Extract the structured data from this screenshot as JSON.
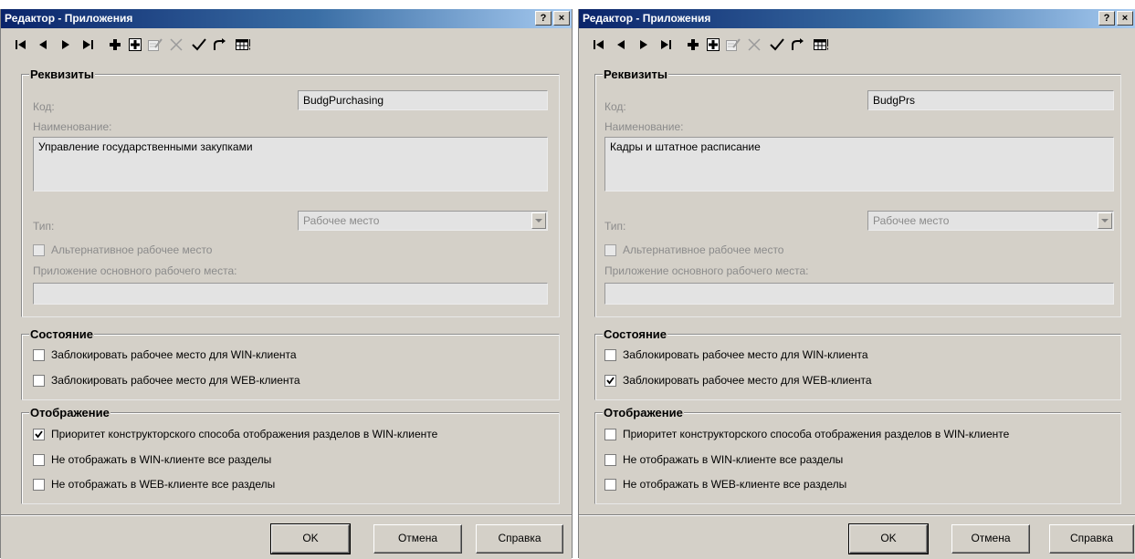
{
  "dialogs": [
    {
      "title": "Редактор - Приложения",
      "title_buttons": [
        "?",
        "×"
      ],
      "requisites": {
        "title": "Реквизиты",
        "code_label": "Код:",
        "code_value": "BudgPurchasing",
        "name_label": "Наименование:",
        "name_value": "Управление государственными закупками",
        "type_label": "Тип:",
        "type_value": "Рабочее место",
        "alt_label": "Альтернативное рабочее место",
        "alt_checked": false,
        "main_app_label": "Приложение основного рабочего места:",
        "main_app_value": ""
      },
      "state": {
        "title": "Состояние",
        "items": [
          {
            "label": "Заблокировать рабочее место для WIN-клиента",
            "checked": false
          },
          {
            "label": "Заблокировать рабочее место для WEB-клиента",
            "checked": false
          }
        ]
      },
      "display": {
        "title": "Отображение",
        "items": [
          {
            "label": "Приоритет конструкторского способа отображения разделов в WIN-клиенте",
            "checked": true
          },
          {
            "label": "Не отображать в WIN-клиенте все разделы",
            "checked": false
          },
          {
            "label": "Не отображать в WEB-клиенте все разделы",
            "checked": false
          }
        ]
      },
      "buttons": {
        "ok": "OK",
        "cancel": "Отмена",
        "help": "Справка"
      }
    },
    {
      "title": "Редактор - Приложения",
      "title_buttons": [
        "?",
        "×"
      ],
      "requisites": {
        "title": "Реквизиты",
        "code_label": "Код:",
        "code_value": "BudgPrs",
        "name_label": "Наименование:",
        "name_value": "Кадры и штатное расписание",
        "type_label": "Тип:",
        "type_value": "Рабочее место",
        "alt_label": "Альтернативное рабочее место",
        "alt_checked": false,
        "main_app_label": "Приложение основного рабочего места:",
        "main_app_value": ""
      },
      "state": {
        "title": "Состояние",
        "items": [
          {
            "label": "Заблокировать рабочее место для WIN-клиента",
            "checked": false
          },
          {
            "label": "Заблокировать рабочее место для WEB-клиента",
            "checked": true
          }
        ]
      },
      "display": {
        "title": "Отображение",
        "items": [
          {
            "label": "Приоритет конструкторского способа отображения разделов в WIN-клиенте",
            "checked": false
          },
          {
            "label": "Не отображать в WIN-клиенте все разделы",
            "checked": false
          },
          {
            "label": "Не отображать в WEB-клиенте все разделы",
            "checked": false
          }
        ]
      },
      "buttons": {
        "ok": "OK",
        "cancel": "Отмена",
        "help": "Справка"
      }
    }
  ],
  "toolbar_icons": [
    "first-record-icon",
    "previous-record-icon",
    "next-record-icon",
    "last-record-icon",
    "add-record-icon",
    "add-copy-icon",
    "edit-record-icon",
    "delete-record-icon",
    "apply-icon",
    "refresh-icon",
    "table-view-icon"
  ],
  "colors": {
    "title_gradient_start": "#0a246a",
    "title_gradient_end": "#a6caf0",
    "dialog_bg": "#d4d0c8",
    "field_bg": "#e3e3e3",
    "disabled_text": "#8b8b8b"
  }
}
